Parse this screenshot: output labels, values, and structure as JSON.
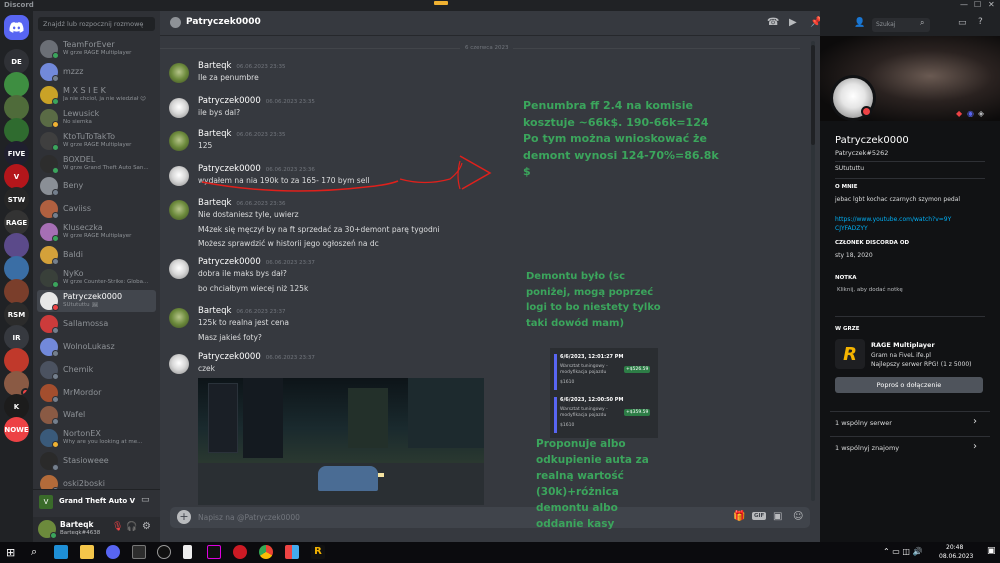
{
  "window": {
    "title": "Discord"
  },
  "dm_search_placeholder": "Znajdź lub rozpocznij rozmowę",
  "servers": [
    {
      "label": "DE",
      "color": "#2f3136"
    },
    {
      "label": "",
      "color": "#3e8e41"
    },
    {
      "label": "",
      "color": "#4f6b3a"
    },
    {
      "label": "",
      "color": "#2f6b2f"
    },
    {
      "label": "FIVE",
      "color": "#1f1f2e"
    },
    {
      "label": "V",
      "color": "#b4161b"
    },
    {
      "label": "STW",
      "color": "#262626"
    },
    {
      "label": "RAGE",
      "color": "#333333"
    },
    {
      "label": "",
      "color": "#5b4a8a"
    },
    {
      "label": "",
      "color": "#3a6ea5"
    },
    {
      "label": "",
      "color": "#7a3e2b"
    },
    {
      "label": "RSM",
      "color": "#2b2b2b"
    },
    {
      "label": "IR",
      "color": "#36393f"
    },
    {
      "label": "",
      "color": "#c0392b"
    },
    {
      "label": "",
      "color": "#8a5a44"
    },
    {
      "label": "K",
      "color": "#1c1c1c"
    },
    {
      "label": "NOWE",
      "color": "#ed4245"
    }
  ],
  "dms": [
    {
      "name": "TeamForEver",
      "sub": "W grze RAGE Multiplayer",
      "color": "#6b6f76",
      "status": "#3ba55c"
    },
    {
      "name": "mzzz",
      "sub": "",
      "color": "#7289da",
      "status": "#747f8d"
    },
    {
      "name": "M X S I E K",
      "sub": "Ja nie chcioł, ja nie wiedział 😉",
      "color": "#c9a227",
      "status": "#3ba55c"
    },
    {
      "name": "Lewusick",
      "sub": "No siemka",
      "color": "#5a6b45",
      "status": "#f0b232"
    },
    {
      "name": "KtoTuToTakTo",
      "sub": "W grze RAGE Multiplayer",
      "color": "#3f3f3f",
      "status": "#3ba55c"
    },
    {
      "name": "BOXDEL",
      "sub": "W grze Grand Theft Auto San...",
      "color": "#2d2d2d",
      "status": "#3ba55c"
    },
    {
      "name": "Beny",
      "sub": "",
      "color": "#8a8f96",
      "status": "#747f8d"
    },
    {
      "name": "Caviiss",
      "sub": "",
      "color": "#b06040",
      "status": "#747f8d"
    },
    {
      "name": "Kluseczka",
      "sub": "W grze RAGE Multiplayer",
      "color": "#a66fb5",
      "status": "#3ba55c"
    },
    {
      "name": "Baldi",
      "sub": "",
      "color": "#d4a13a",
      "status": "#747f8d"
    },
    {
      "name": "NyKo",
      "sub": "W grze Counter-Strike: Globa...",
      "color": "#39403a",
      "status": "#3ba55c"
    },
    {
      "name": "Patryczek0000",
      "sub": "SUtututtu 🖼",
      "color": "#e8e8e8",
      "status": "#ed4245"
    },
    {
      "name": "Sallamossa",
      "sub": "",
      "color": "#cc3b3b",
      "status": "#747f8d"
    },
    {
      "name": "WolnoLukasz",
      "sub": "",
      "color": "#7289da",
      "status": "#747f8d"
    },
    {
      "name": "Chemik",
      "sub": "",
      "color": "#4b5260",
      "status": "#747f8d"
    },
    {
      "name": "MrMordor",
      "sub": "",
      "color": "#a34e2e",
      "status": "#747f8d"
    },
    {
      "name": "Wafel",
      "sub": "",
      "color": "#8a5a44",
      "status": "#747f8d"
    },
    {
      "name": "NortonEX",
      "sub": "Why are you looking at me...",
      "color": "#3a5a7a",
      "status": "#f0b232"
    },
    {
      "name": "Stasioweee",
      "sub": "",
      "color": "#2a2a2a",
      "status": "#747f8d"
    },
    {
      "name": "oski2boski",
      "sub": "",
      "color": "#b36b3a",
      "status": "#747f8d"
    }
  ],
  "now_playing": "Grand Theft Auto V",
  "user": {
    "name": "Barteqk",
    "tag": "Barteqk#4638"
  },
  "chat": {
    "channel": "Patryczek0000",
    "search_placeholder": "Szukaj",
    "date_divider": "6 czerwca 2023",
    "input_placeholder": "Napisz na @Patryczek0000",
    "messages": [
      {
        "author": "Barteqk",
        "time": "06.06.2023 23:35",
        "lines": [
          "Ile za penumbre"
        ],
        "avatar": "green"
      },
      {
        "author": "Patryczek0000",
        "time": "06.06.2023 23:35",
        "lines": [
          "ile bys dal?"
        ],
        "avatar": "white"
      },
      {
        "author": "Barteqk",
        "time": "06.06.2023 23:35",
        "lines": [
          "125"
        ],
        "avatar": "green"
      },
      {
        "author": "Patryczek0000",
        "time": "06.06.2023 23:36",
        "lines": [
          "wydałem na nia 190k to za 165- 170 bym sell"
        ],
        "avatar": "white"
      },
      {
        "author": "Barteqk",
        "time": "06.06.2023 23:36",
        "lines": [
          "Nie dostaniesz tyle, uwierz",
          "M4zek się męczył by na ft sprzedać za 30+demont parę tygodni",
          "Możesz sprawdzić w historii jego ogłoszeń na dc"
        ],
        "avatar": "green"
      },
      {
        "author": "Patryczek0000",
        "time": "06.06.2023 23:37",
        "lines": [
          "dobra ile maks bys dał?",
          "bo chciałbym wiecej niż 125k"
        ],
        "avatar": "white"
      },
      {
        "author": "Barteqk",
        "time": "06.06.2023 23:37",
        "lines": [
          "125k to realna jest cena",
          "Masz jakieś foty?"
        ],
        "avatar": "green"
      },
      {
        "author": "Patryczek0000",
        "time": "06.06.2023 23:37",
        "lines": [
          "czek"
        ],
        "avatar": "white"
      }
    ]
  },
  "annotations": {
    "note1": "Penumbra ff 2.4 na komisie kosztuje ~66k$. 190-66k=124 Po tym można wnioskować że demont wynosi 124-70%=86.8k $",
    "note2": "Demontu było (sc poniżej, mogą poprzeć logi to bo niestety tylko taki dowód mam)",
    "note3": "Proponuje albo odkupienie auta za realną wartość (30k)+różnica demontu albo oddanie kasy",
    "receipts": [
      {
        "date": "6/6/2023, 12:01:27 PM",
        "desc": "Warsztat tuningowy - modyfikacja pojazdu",
        "id": "$1610",
        "amount": "+$526.59"
      },
      {
        "date": "6/6/2023, 12:00:50 PM",
        "desc": "Warsztat tuningowy - modyfikacja pojazdu",
        "id": "$1610",
        "amount": "+$359.59"
      }
    ]
  },
  "profile": {
    "display_name": "Patryczek0000",
    "tag": "Patryczek#5262",
    "custom_status": "SUtututtu",
    "about_label": "O mnie",
    "about_text": "jebac lgbt kochac czarnych szymon pedal",
    "about_link": "https://www.youtube.com/watch?v=9YCJYFADZYY",
    "member_since_label": "Członek Discorda od",
    "member_since": "sty 18, 2020",
    "note_label": "Notka",
    "note_placeholder": "Kliknij, aby dodać notkę",
    "in_game_label": "W grze",
    "game": "RAGE Multiplayer",
    "game_detail1": "Gram na FiveL ife.pl",
    "game_detail2": "Najlepszy serwer RPG! (1 z 5000)",
    "join_button": "Poproś o dołączenie",
    "mutual_servers": "1 wspólny serwer",
    "mutual_friends": "1 wspólnyj znajomy"
  },
  "taskbar": {
    "time": "20:48",
    "date": "08.06.2023"
  },
  "colors": {
    "accent": "#5865f2",
    "annotation": "#3ba55c",
    "drawing": "#e0201b"
  }
}
